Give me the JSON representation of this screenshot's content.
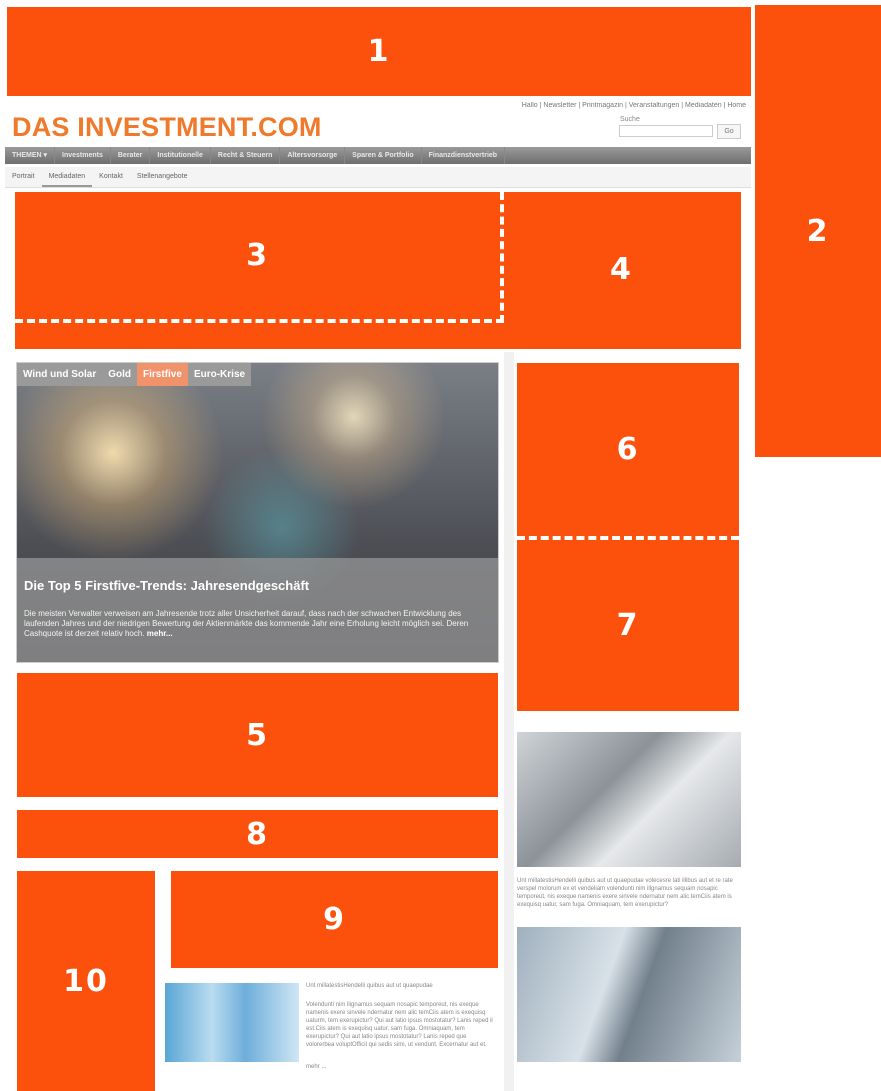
{
  "site": {
    "logo": "DAS INVESTMENT.COM",
    "toplinks": "Hallo | Newsletter | Printmagazin | Veranstaltungen | Mediadaten | Home",
    "search_label": "Suche",
    "search_button": "Go",
    "main_nav": [
      "THEMEN ▾",
      "Investments",
      "Berater",
      "Institutionelle",
      "Recht & Steuern",
      "Altersvorsorge",
      "Sparen & Portfolio",
      "Finanzdienstvertrieb"
    ],
    "sub_nav": [
      "Portrait",
      "Mediadaten",
      "Kontakt",
      "Stellenangebote"
    ]
  },
  "hero": {
    "tabs": [
      "Wind und Solar",
      "Gold",
      "Firstfive",
      "Euro-Krise"
    ],
    "title": "Die Top 5 Firstfive-Trends: Jahresendgeschäft",
    "text": "Die meisten Verwalter verweisen am Jahresende trotz aller Unsicherheit darauf, dass nach der schwachen Entwicklung des laufenden Jahres und der niedrigen Bewertung der Aktienmärkte das kommende Jahr eine Erholung leicht möglich sei. Deren Cashquote ist derzeit relativ hoch.",
    "more": "mehr..."
  },
  "sidebar": {
    "rail_text": "Unt millatestisHendelli quibus aut ut quaepudae volecesre lati illibus aut et re rate verspel molorum ex et vendeliam volendunti nim illgnamus sequam nosapic temporeut, nis exeque namenis exere sinvele ndernatur nem alic temCiis atem is exequisq uatur, sam fuga. Omniaquam, tem exerupictur?"
  },
  "teaser": {
    "title": "Unt millatestisHendelli quibus aut ut quaepudae",
    "body": "Volendunti nim llignamus sequam nosapic temporeut, nis exeque namenis exere sinvele ndernatur nem alic temCiis atem is exequisq uaturm, tem exerupictur? Qui aut latio ipsus mostotatur? Lanis reped il est.Ciis atem is exequisq uatur, sam fuga. Omniaquam, tem exerupictur? Qui aut latio ipsus mostotatur? Lanis reped que volorerbea voluptOfficil qui sedis simi, ut vendunt. Excernatur aut et.",
    "more": "mehr ..."
  },
  "ad_slots": [
    "1",
    "2",
    "3",
    "4",
    "5",
    "6",
    "7",
    "8",
    "9",
    "10"
  ],
  "colors": {
    "slot": "#fc510d",
    "logo": "#f07a2b"
  }
}
